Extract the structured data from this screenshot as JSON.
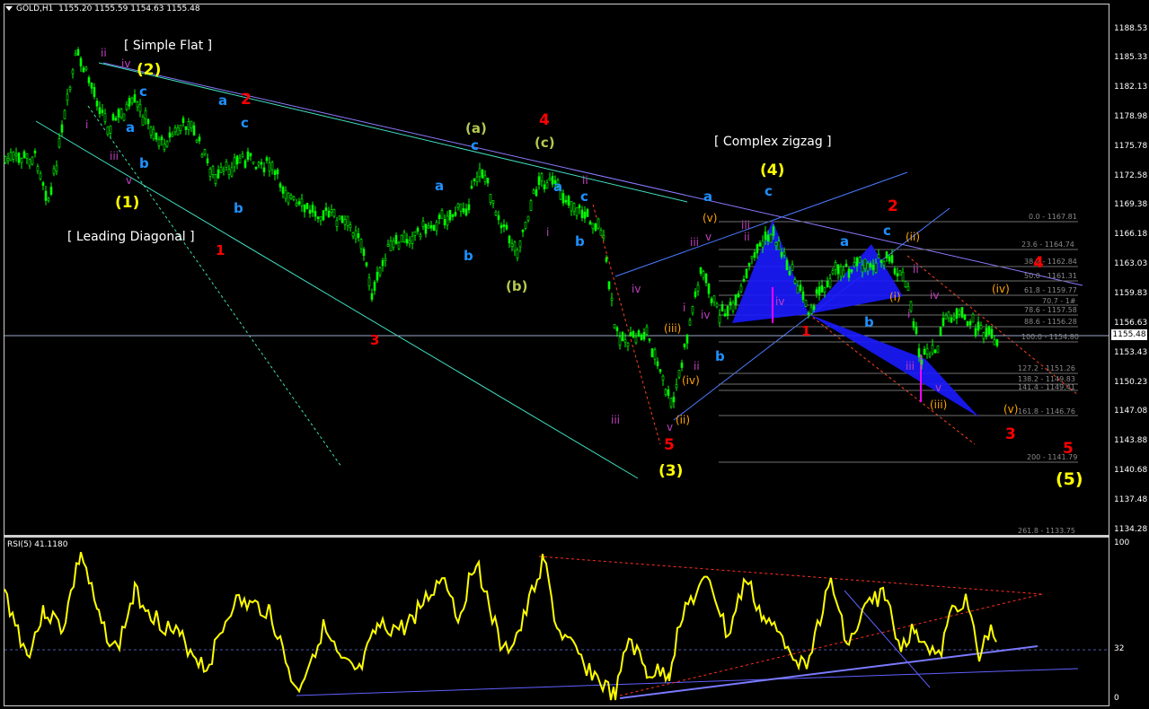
{
  "header": {
    "symbol": "GOLD,H1",
    "ohlc": "1155.20 1155.59 1154.63 1155.48"
  },
  "rsi": {
    "title": "RSI(5) 41.1180",
    "axis": [
      "100",
      "32",
      "0"
    ]
  },
  "price_axis": [
    "1188.53",
    "1185.33",
    "1182.13",
    "1178.98",
    "1175.78",
    "1172.58",
    "1169.38",
    "1166.18",
    "1163.03",
    "1159.83",
    "1156.63",
    "1153.43",
    "1150.23",
    "1147.08",
    "1143.88",
    "1140.68",
    "1137.48",
    "1134.28"
  ],
  "current_price": "1155.48",
  "notes": {
    "simple_flat": "[ Simple Flat ]",
    "leading_diagonal": "[ Leading Diagonal ]",
    "complex_zigzag": "[ Complex zigzag ]"
  },
  "fib_levels": [
    "0.0 - 1167.81",
    "23.6 - 1164.74",
    "38.2 - 1162.84",
    "50.0 - 1161.31",
    "61.8 - 1159.77",
    "70.7 - 1#",
    "78.6 - 1157.58",
    "88.6 - 1156.28",
    "100.0 - 1154.80",
    "127.2 - 1151.26",
    "138.2 - 1149.83",
    "141.4 - 1149.41",
    "161.8 - 1146.76",
    "200 - 1141.79",
    "261.8 - 1133.75"
  ],
  "wave_labels": [
    "ii",
    "iv",
    "(2)",
    "c",
    "a",
    "b",
    "i",
    "iii",
    "v",
    "(1)",
    "[ Leading Diagonal ]",
    "2",
    "a",
    "c",
    "b",
    "1",
    "3",
    "(a)",
    "c",
    "a",
    "b",
    "(b)",
    "4",
    "(c)",
    "ii",
    "a",
    "c",
    "b",
    "i",
    "iv",
    "iii",
    "5",
    "(3)",
    "(iii)",
    "(iv)",
    "(ii)",
    "v",
    "ii",
    "iii",
    "i",
    "iv",
    "b",
    "iii",
    "a",
    "(v)",
    "v",
    "(4)",
    "c",
    "ii",
    "iv",
    "1",
    "b",
    "a",
    "c",
    "2",
    "(ii)",
    "(i)",
    "i",
    "iv",
    "ii",
    "iii",
    "v",
    "(iii)",
    "(iv)",
    "(v)",
    "3",
    "4",
    "5",
    "(5)"
  ],
  "colors": {
    "candle": "#00ff00",
    "rsi_line": "#ffff00",
    "wave_red": "#ff0000",
    "wave_blue": "#1e90ff",
    "wave_yellow": "#ffff00",
    "wave_magenta": "#c040c0",
    "wave_orange": "#ffa500",
    "wave_olive": "#b4c850",
    "harmonic_fill": "#0000ff"
  }
}
